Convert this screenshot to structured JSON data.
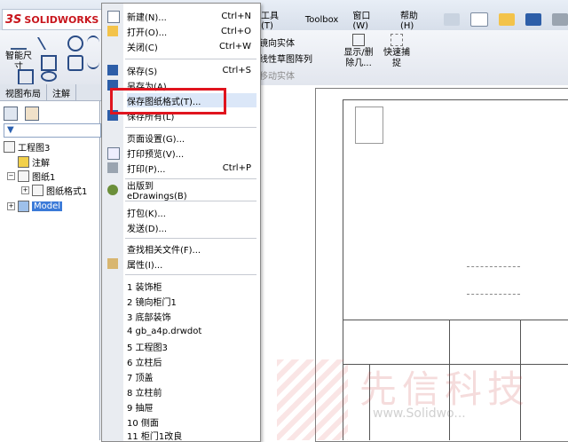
{
  "app": {
    "logo_prefix": "3S",
    "logo_name": "SOLIDWORKS"
  },
  "menubar": [
    "工具(T)",
    "Toolbox",
    "窗口(W)",
    "帮助(H)"
  ],
  "command_manager": {
    "smart_dim_label": "智能尺寸",
    "mirror_label": "镜向实体",
    "linear_pattern_label": "线性草图阵列",
    "move_label": "移动实体",
    "show_hide_label": "显示/删除几...",
    "quick_snap_label": "快速捕捉"
  },
  "tabs": [
    "视图布局",
    "注解"
  ],
  "tree": {
    "root": "工程图3",
    "items": [
      "注解",
      "图纸1",
      "图纸格式1",
      "Model"
    ]
  },
  "file_menu": {
    "items": [
      {
        "label": "新建(N)...",
        "shortcut": "Ctrl+N"
      },
      {
        "label": "打开(O)...",
        "shortcut": "Ctrl+O"
      },
      {
        "label": "关闭(C)",
        "shortcut": "Ctrl+W"
      },
      {
        "label": "保存(S)",
        "shortcut": "Ctrl+S"
      },
      {
        "label": "另存为(A)...",
        "shortcut": ""
      },
      {
        "label": "保存图纸格式(T)...",
        "shortcut": ""
      },
      {
        "label": "保存所有(L)",
        "shortcut": ""
      },
      {
        "label": "页面设置(G)...",
        "shortcut": ""
      },
      {
        "label": "打印预览(V)...",
        "shortcut": ""
      },
      {
        "label": "打印(P)...",
        "shortcut": "Ctrl+P"
      },
      {
        "label": "出版到 eDrawings(B)",
        "shortcut": ""
      },
      {
        "label": "打包(K)...",
        "shortcut": ""
      },
      {
        "label": "发送(D)...",
        "shortcut": ""
      },
      {
        "label": "查找相关文件(F)...",
        "shortcut": ""
      },
      {
        "label": "属性(I)...",
        "shortcut": ""
      },
      {
        "label": "1 装饰柜",
        "shortcut": ""
      },
      {
        "label": "2 镜向柜门1",
        "shortcut": ""
      },
      {
        "label": "3 底部装饰",
        "shortcut": ""
      },
      {
        "label": "4 gb_a4p.drwdot",
        "shortcut": ""
      },
      {
        "label": "5 工程图3",
        "shortcut": ""
      },
      {
        "label": "6 立柱后",
        "shortcut": ""
      },
      {
        "label": "7 顶盖",
        "shortcut": ""
      },
      {
        "label": "8 立柱前",
        "shortcut": ""
      },
      {
        "label": "9 抽屉",
        "shortcut": ""
      },
      {
        "label": "10 侧面",
        "shortcut": ""
      },
      {
        "label": "11 柜门1改良",
        "shortcut": ""
      }
    ]
  },
  "watermark": {
    "text": "先信科技",
    "url": "www.Solidwo..."
  },
  "colors": {
    "highlight": "#e0141e",
    "brand": "#c8161d"
  }
}
